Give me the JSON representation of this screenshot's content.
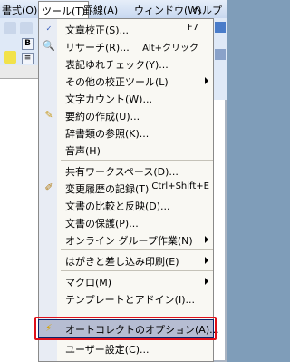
{
  "menubar": {
    "format": "書式(O)",
    "tools": "ツール(T)",
    "table": "罫線(A)",
    "window": "ウィンドウ(W)",
    "help": "ヘルプ"
  },
  "toolbar": {
    "bold": "B",
    "align": "≡"
  },
  "menu": {
    "items": [
      {
        "label": "文章校正(S)...",
        "shortcut": "F7",
        "icon": "abc-check-icon"
      },
      {
        "label": "リサーチ(R)...",
        "shortcut": "Alt+クリック",
        "icon": "research-icon"
      },
      {
        "label": "表記ゆれチェック(Y)..."
      },
      {
        "label": "その他の校正ツール(L)",
        "submenu": true
      },
      {
        "label": "文字カウント(W)..."
      },
      {
        "label": "要約の作成(U)...",
        "icon": "summary-icon"
      },
      {
        "label": "辞書類の参照(K)..."
      },
      {
        "label": "音声(H)"
      },
      {
        "label": "共有ワークスペース(D)..."
      },
      {
        "label": "変更履歴の記録(T)",
        "shortcut": "Ctrl+Shift+E",
        "icon": "track-changes-icon"
      },
      {
        "label": "文書の比較と反映(D)..."
      },
      {
        "label": "文書の保護(P)..."
      },
      {
        "label": "オンライン グループ作業(N)",
        "submenu": true
      },
      {
        "label": "はがきと差し込み印刷(E)",
        "submenu": true
      },
      {
        "label": "マクロ(M)",
        "submenu": true
      },
      {
        "label": "テンプレートとアドイン(I)..."
      },
      {
        "label": "オートコレクトのオプション(A)...",
        "icon": "autocorrect-icon"
      },
      {
        "label": "ユーザー設定(C)..."
      }
    ]
  },
  "colors": {
    "highlight_border": "#e0101a",
    "menu_bg": "#f9f8f3"
  }
}
